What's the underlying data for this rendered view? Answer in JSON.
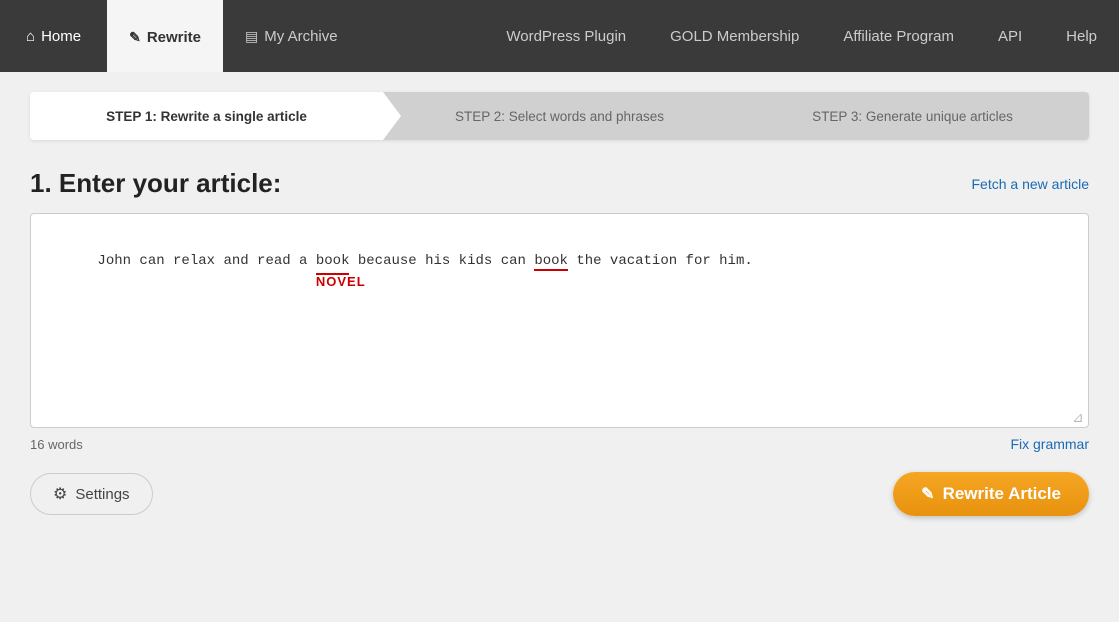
{
  "nav": {
    "home_label": "Home",
    "rewrite_label": "Rewrite",
    "archive_label": "My Archive",
    "wordpress_label": "WordPress Plugin",
    "gold_label": "GOLD Membership",
    "affiliate_label": "Affiliate Program",
    "api_label": "API",
    "help_label": "Help"
  },
  "steps": {
    "step1_label": "STEP 1: Rewrite a single article",
    "step2_label": "STEP 2: Select words and phrases",
    "step3_label": "STEP 3: Generate unique articles"
  },
  "article": {
    "heading": "1. Enter your article:",
    "fetch_link": "Fetch a new article",
    "content_line1": "John can relax and read a book because his kids can book the vacation for him.",
    "tooltip_word": "NOVEL",
    "word_count": "16 words",
    "fix_grammar": "Fix grammar"
  },
  "buttons": {
    "settings_label": "Settings",
    "rewrite_label": "Rewrite Article"
  },
  "colors": {
    "accent_orange": "#f5a623",
    "link_blue": "#1a6ab5",
    "error_red": "#cc0000"
  }
}
